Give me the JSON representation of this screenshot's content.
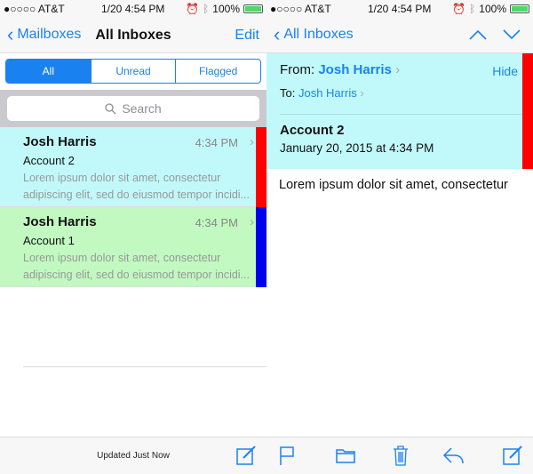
{
  "status": {
    "carrier": "●○○○○ AT&T",
    "time": "1/20 4:54 PM",
    "battery": "100%"
  },
  "left": {
    "nav": {
      "back": "Mailboxes",
      "title": "All Inboxes",
      "edit": "Edit"
    },
    "segments": [
      "All",
      "Unread",
      "Flagged"
    ],
    "search_placeholder": "Search",
    "messages": [
      {
        "from": "Josh Harris",
        "time": "4:34 PM",
        "subject": "Account 2",
        "preview1": "Lorem ipsum dolor sit amet, consectetur",
        "preview2": "adipiscing elit, sed do eiusmod tempor incidi...",
        "bg": "#c1f9fb",
        "bar": "#ff0000"
      },
      {
        "from": "Josh Harris",
        "time": "4:34 PM",
        "subject": "Account 1",
        "preview1": "Lorem ipsum dolor sit amet, consectetur",
        "preview2": "adipiscing elit, sed do eiusmod tempor incidi...",
        "bg": "#c1f9c1",
        "bar": "#0000ee"
      }
    ],
    "toolbar": {
      "status": "Updated Just Now"
    }
  },
  "right": {
    "nav": {
      "back": "All Inboxes"
    },
    "from_label": "From:",
    "from": "Josh Harris",
    "hide": "Hide",
    "to_label": "To:",
    "to": "Josh Harris",
    "subject": "Account 2",
    "date": "January 20, 2015 at 4:34 PM",
    "body": "Lorem ipsum dolor sit amet, consectetur"
  },
  "accent": "#1a82f0"
}
